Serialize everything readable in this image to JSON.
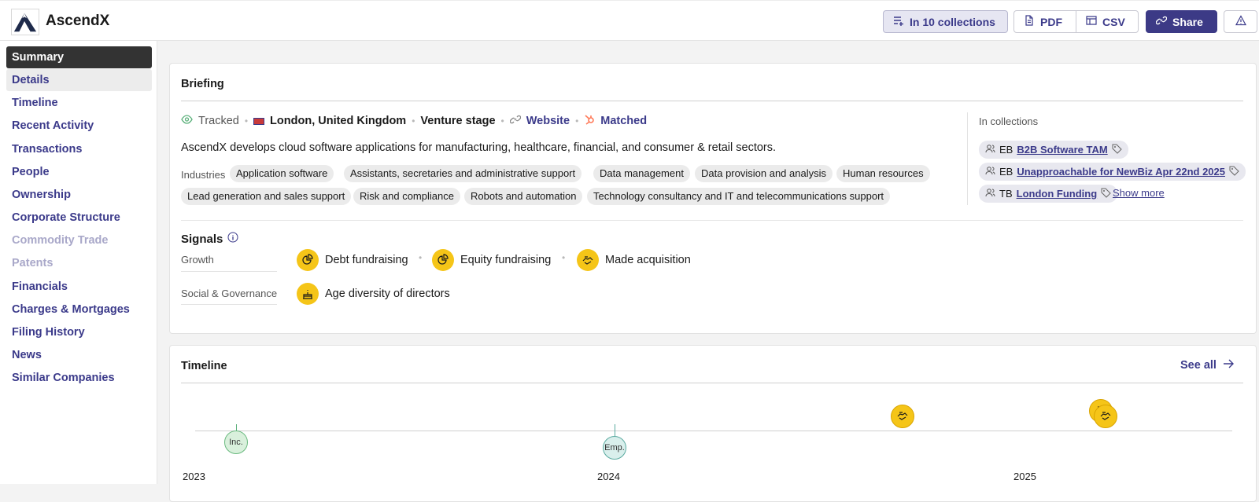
{
  "app": {
    "name": "AscendX"
  },
  "toolbar": {
    "collections_label": "In 10 collections",
    "pdf_label": "PDF",
    "csv_label": "CSV",
    "share_label": "Share"
  },
  "sidebar": {
    "items": [
      {
        "label": "Summary",
        "state": "active"
      },
      {
        "label": "Details",
        "state": "hover"
      },
      {
        "label": "Timeline",
        "state": "normal"
      },
      {
        "label": "Recent Activity",
        "state": "normal"
      },
      {
        "label": "Transactions",
        "state": "normal"
      },
      {
        "label": "People",
        "state": "normal"
      },
      {
        "label": "Ownership",
        "state": "normal"
      },
      {
        "label": "Corporate Structure",
        "state": "normal"
      },
      {
        "label": "Commodity Trade",
        "state": "disabled"
      },
      {
        "label": "Patents",
        "state": "disabled"
      },
      {
        "label": "Financials",
        "state": "normal"
      },
      {
        "label": "Charges & Mortgages",
        "state": "normal"
      },
      {
        "label": "Filing History",
        "state": "normal"
      },
      {
        "label": "News",
        "state": "normal"
      },
      {
        "label": "Similar Companies",
        "state": "normal"
      }
    ]
  },
  "briefing": {
    "title": "Briefing",
    "tracked": "Tracked",
    "location": "London, United Kingdom",
    "stage": "Venture stage",
    "website": "Website",
    "matched": "Matched",
    "description": "AscendX develops cloud software applications for manufacturing, healthcare, financial, and consumer & retail sectors.",
    "industries_label": "Industries",
    "industries": [
      "Application software",
      "Assistants, secretaries and administrative support",
      "Data management",
      "Data provision and analysis",
      "Human resources",
      "Lead generation and sales support",
      "Risk and compliance",
      "Robots and automation",
      "Technology consultancy and IT and telecommunications support"
    ],
    "collections_title": "In collections",
    "collections": [
      {
        "initials": "EB",
        "name": "B2B Software TAM"
      },
      {
        "initials": "EB",
        "name": "Unapproachable for NewBiz Apr 22nd 2025"
      },
      {
        "initials": "TB",
        "name": "London Funding"
      }
    ],
    "show_more": "Show more",
    "signals_title": "Signals",
    "signal_groups": [
      {
        "label": "Growth",
        "signals": [
          "Debt fundraising",
          "Equity fundraising",
          "Made acquisition"
        ]
      },
      {
        "label": "Social & Governance",
        "signals": [
          "Age diversity of directors"
        ]
      }
    ]
  },
  "timeline": {
    "title": "Timeline",
    "see_all": "See all",
    "years": [
      "2023",
      "2024",
      "2025"
    ],
    "events": [
      {
        "label": "Inc.",
        "kind": "incorporation"
      },
      {
        "label": "Emp.",
        "kind": "employees"
      },
      {
        "label": "",
        "kind": "acquisition"
      },
      {
        "label": "",
        "kind": "acquisition"
      },
      {
        "label": "",
        "kind": "acquisition"
      }
    ]
  },
  "colors": {
    "accent": "#3c3a86",
    "signal": "#f5c518",
    "active_nav": "#333333"
  }
}
